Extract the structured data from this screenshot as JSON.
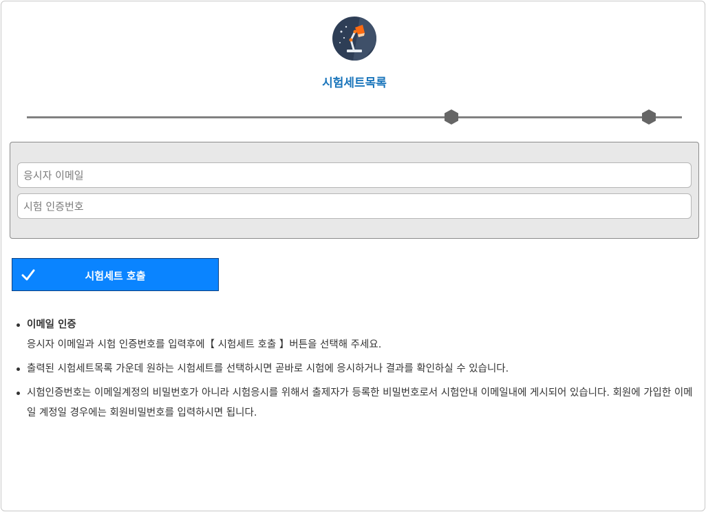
{
  "app": {
    "logo_icon": "desk-lamp-icon",
    "title": "시험세트목록"
  },
  "progress": {
    "step_count": 2,
    "current_step": 1
  },
  "form": {
    "email_placeholder": "응시자 이메일",
    "email_value": "",
    "auth_placeholder": "시험 인증번호",
    "auth_value": ""
  },
  "submit": {
    "icon": "check-icon",
    "label": "시험세트 호출"
  },
  "info": {
    "items": [
      {
        "title": "이메일 인증",
        "text": "응시자 이메일과 시험 인증번호를 입력후에【 시험세트 호출 】버튼을 선택해 주세요."
      },
      {
        "text": "출력된 시험세트목록 가운데 원하는 시험세트를 선택하시면 곧바로 시험에 응시하거나 결과를 확인하실 수 있습니다."
      },
      {
        "text": "시험인증번호는 이메일계정의 비밀번호가 아니라 시험응시를 위해서 출제자가 등록한 비밀번호로서 시험안내 이메일내에 게시되어 있습니다. 회원에 가입한 이메일 계정일 경우에는 회원비밀번호를 입력하시면 됩니다."
      }
    ]
  },
  "colors": {
    "title": "#1a75bb",
    "button": "#0a84ff",
    "panel": "#e8e8e8",
    "progress": "#808080",
    "node": "#666666"
  }
}
